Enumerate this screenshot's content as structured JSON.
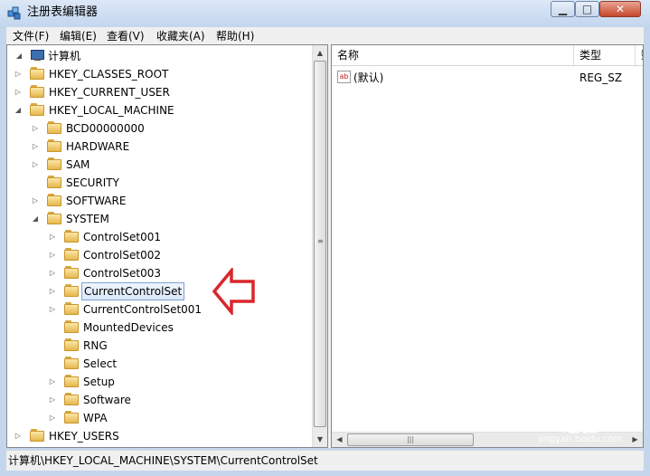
{
  "window": {
    "title": "注册表编辑器",
    "controls": {
      "minimize": "▁",
      "maximize": "□",
      "close": "✕"
    }
  },
  "menu": [
    "文件(F)",
    "编辑(E)",
    "查看(V)",
    "收藏夹(A)",
    "帮助(H)"
  ],
  "tree": {
    "root": "计算机",
    "nodes": [
      {
        "label": "HKEY_CLASSES_ROOT",
        "expander": "▷"
      },
      {
        "label": "HKEY_CURRENT_USER",
        "expander": "▷"
      },
      {
        "label": "HKEY_LOCAL_MACHINE",
        "expander": "◢"
      },
      {
        "label": "BCD00000000",
        "expander": "▷"
      },
      {
        "label": "HARDWARE",
        "expander": "▷"
      },
      {
        "label": "SAM",
        "expander": "▷"
      },
      {
        "label": "SECURITY",
        "expander": ""
      },
      {
        "label": "SOFTWARE",
        "expander": "▷"
      },
      {
        "label": "SYSTEM",
        "expander": "◢"
      },
      {
        "label": "ControlSet001",
        "expander": "▷"
      },
      {
        "label": "ControlSet002",
        "expander": "▷"
      },
      {
        "label": "ControlSet003",
        "expander": "▷"
      },
      {
        "label": "CurrentControlSet",
        "expander": "▷",
        "selected": true
      },
      {
        "label": "CurrentControlSet001",
        "expander": "▷"
      },
      {
        "label": "MountedDevices",
        "expander": ""
      },
      {
        "label": "RNG",
        "expander": ""
      },
      {
        "label": "Select",
        "expander": ""
      },
      {
        "label": "Setup",
        "expander": "▷"
      },
      {
        "label": "Software",
        "expander": "▷"
      },
      {
        "label": "WPA",
        "expander": "▷"
      },
      {
        "label": "HKEY_USERS",
        "expander": "▷"
      }
    ]
  },
  "values_pane": {
    "columns": [
      "名称",
      "类型",
      "数"
    ],
    "rows": [
      {
        "name": "(默认)",
        "type": "REG_SZ",
        "icon": "ab-icon",
        "icon_text": "ab"
      }
    ]
  },
  "status_bar": "计算机\\HKEY_LOCAL_MACHINE\\SYSTEM\\CurrentControlSet",
  "watermark": {
    "brand": "Bai",
    "brand2": "经验",
    "url": "jingyan.baidu.com"
  },
  "colors": {
    "selection": "#dbe9fa",
    "annotation_arrow": "#d9262b",
    "folder": "#e6b74d"
  }
}
